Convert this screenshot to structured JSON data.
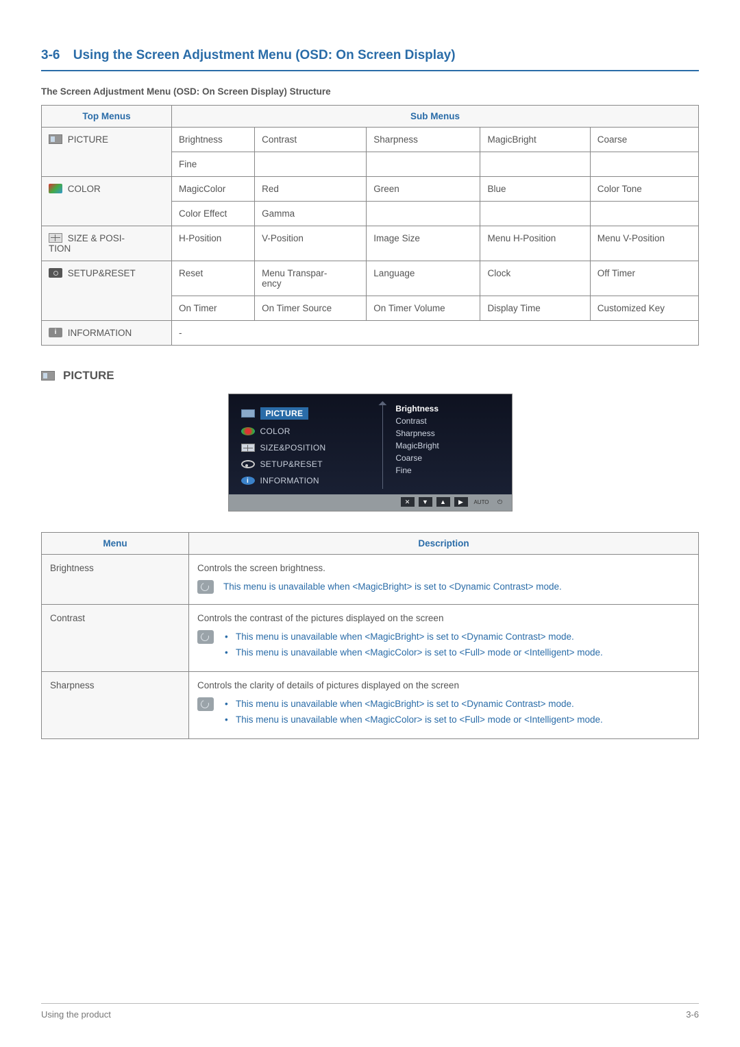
{
  "section": {
    "num": "3-6",
    "title": "Using the Screen Adjustment Menu (OSD: On Screen Display)"
  },
  "subtitle": "The Screen Adjustment Menu (OSD: On Screen Display) Structure",
  "structure": {
    "headers": {
      "top": "Top Menus",
      "sub": "Sub Menus"
    },
    "rows": [
      {
        "menu": "PICTURE",
        "icon": "picture",
        "cells": [
          [
            "Brightness",
            "Contrast",
            "Sharpness",
            "MagicBright",
            "Coarse"
          ],
          [
            "Fine",
            "",
            "",
            "",
            ""
          ]
        ]
      },
      {
        "menu": "COLOR",
        "icon": "color",
        "cells": [
          [
            "MagicColor",
            "Red",
            "Green",
            "Blue",
            "Color Tone"
          ],
          [
            "Color Effect",
            "Gamma",
            "",
            "",
            ""
          ]
        ]
      },
      {
        "menu": "SIZE & POSI-TION",
        "icon": "size",
        "cells": [
          [
            "H-Position",
            "V-Position",
            "Image Size",
            "Menu H-Position",
            "Menu V-Position"
          ]
        ]
      },
      {
        "menu": "SETUP&RESET",
        "icon": "setup",
        "cells": [
          [
            "Reset",
            "Menu Transpar-ency",
            "Language",
            "Clock",
            "Off Timer"
          ],
          [
            "On Timer",
            "On Timer Source",
            "On Timer Volume",
            "Display Time",
            "Customized Key"
          ]
        ]
      },
      {
        "menu": "INFORMATION",
        "icon": "info",
        "cells": [
          [
            "-",
            "",
            "",
            "",
            ""
          ]
        ]
      }
    ]
  },
  "picture_heading": "PICTURE",
  "osd": {
    "left": [
      "PICTURE",
      "COLOR",
      "SIZE&POSITION",
      "SETUP&RESET",
      "INFORMATION"
    ],
    "right": [
      "Brightness",
      "Contrast",
      "Sharpness",
      "MagicBright",
      "Coarse",
      "Fine"
    ],
    "buttons": [
      "✕",
      "▼",
      "▲",
      "▶",
      "AUTO",
      "⏻"
    ]
  },
  "desc": {
    "headers": {
      "menu": "Menu",
      "description": "Description"
    },
    "rows": [
      {
        "menu": "Brightness",
        "text": "Controls the screen brightness.",
        "notes": [
          "This menu is unavailable when <MagicBright> is set to <Dynamic Contrast> mode."
        ]
      },
      {
        "menu": "Contrast",
        "text": "Controls the contrast of the pictures displayed on the screen",
        "notes": [
          "This menu is unavailable when <MagicBright> is set to <Dynamic Contrast> mode.",
          "This menu is unavailable when <MagicColor> is set to <Full> mode or <Intelligent> mode."
        ]
      },
      {
        "menu": "Sharpness",
        "text": "Controls the clarity of details of pictures displayed on the screen",
        "notes": [
          "This menu is unavailable when <MagicBright> is set to <Dynamic Contrast> mode.",
          "This menu is unavailable when <MagicColor> is set to <Full> mode or <Intelligent> mode."
        ]
      }
    ]
  },
  "footer": {
    "left": "Using the product",
    "right": "3-6"
  }
}
